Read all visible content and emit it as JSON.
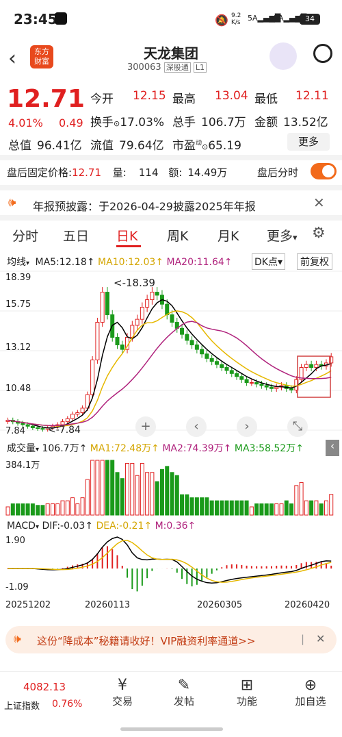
{
  "status": {
    "time": "23:45",
    "net": "9.2\nK/s",
    "battery": "34"
  },
  "header": {
    "title": "天龙集团",
    "code": "300063",
    "market": "深股通",
    "level": "L1",
    "logo_line1": "东方",
    "logo_line2": "财富"
  },
  "quote": {
    "price": "12.71",
    "pct": "4.01%",
    "chg": "0.49",
    "open_label": "今开",
    "open": "12.15",
    "high_label": "最高",
    "high": "13.04",
    "low_label": "最低",
    "low": "12.11",
    "turnover_label": "换手",
    "turnover": "17.03%",
    "vol_label": "总手",
    "vol": "106.7万",
    "amount_label": "金额",
    "amount": "13.52亿",
    "mcap_label": "总值",
    "mcap": "96.41亿",
    "float_label": "流值",
    "float": "79.64亿",
    "pe_label": "市盈",
    "pe_sup": "动",
    "pe": "65.19",
    "more": "更多"
  },
  "after": {
    "label": "盘后固定价格:",
    "price": "12.71",
    "qty_label": "量:",
    "qty": "114",
    "amt_label": "额:",
    "amt": "14.49万",
    "timeshare": "盘后分时"
  },
  "notice": {
    "text": "年报预披露：于2026-04-29披露2025年年报"
  },
  "tabs": [
    "分时",
    "五日",
    "日K",
    "周K",
    "月K",
    "更多"
  ],
  "ma": {
    "label": "均线",
    "ma5": "MA5:12.18",
    "ma10": "MA10:12.03",
    "ma20": "MA20:11.64",
    "dk": "DK点",
    "fq": "前复权"
  },
  "price_axis": [
    "18.39",
    "15.75",
    "13.12",
    "10.48",
    "7.84"
  ],
  "annotations": {
    "high": "<-18.39",
    "low": "<-7.84"
  },
  "vol_bar": {
    "label": "成交量",
    "vol": "106.7万",
    "ma1": "MA1:72.48万",
    "ma2": "MA2:74.39万",
    "ma3": "MA3:58.52万",
    "max": "384.1万"
  },
  "macd": {
    "label": "MACD",
    "dif": "DIF:-0.03",
    "dea": "DEA:-0.21",
    "m": "M:0.36",
    "top": "1.90",
    "bottom": "-1.09"
  },
  "dates": [
    "20251202",
    "20260113",
    "20260305",
    "20260420"
  ],
  "banner": {
    "text": "这份“降成本”秘籍请收好！VIP融资利率通道>>"
  },
  "bottom": {
    "index_val": "4082.13",
    "index_name": "上证指数",
    "index_pct": "0.76%",
    "trade": "交易",
    "post": "发帖",
    "func": "功能",
    "add": "加自选"
  },
  "colors": {
    "up": "#e02020",
    "down": "#1a9a1a",
    "ma5": "#000000",
    "ma10": "#e6b800",
    "ma20": "#b0237d",
    "accent": "#f26a1b"
  },
  "chart_data": {
    "type": "candlestick",
    "ylim": [
      7.84,
      18.39
    ],
    "close": [
      8.5,
      8.4,
      8.3,
      8.2,
      8.1,
      8.0,
      7.95,
      7.9,
      8.0,
      8.1,
      8.2,
      8.4,
      8.6,
      8.9,
      9.0,
      9.3,
      10.2,
      12.5,
      15.0,
      17.0,
      15.5,
      14.0,
      13.5,
      13.2,
      14.0,
      14.8,
      15.2,
      16.0,
      16.5,
      17.0,
      16.8,
      16.2,
      15.5,
      15.0,
      14.6,
      14.2,
      13.8,
      13.5,
      13.2,
      12.9,
      12.6,
      12.4,
      12.2,
      12.0,
      11.8,
      11.6,
      11.4,
      11.2,
      11.0,
      11.0,
      10.9,
      10.8,
      10.7,
      10.6,
      10.7,
      10.8,
      10.6,
      10.5,
      11.2,
      12.0,
      12.2,
      12.0,
      12.2,
      12.1,
      12.3,
      12.71
    ]
  }
}
